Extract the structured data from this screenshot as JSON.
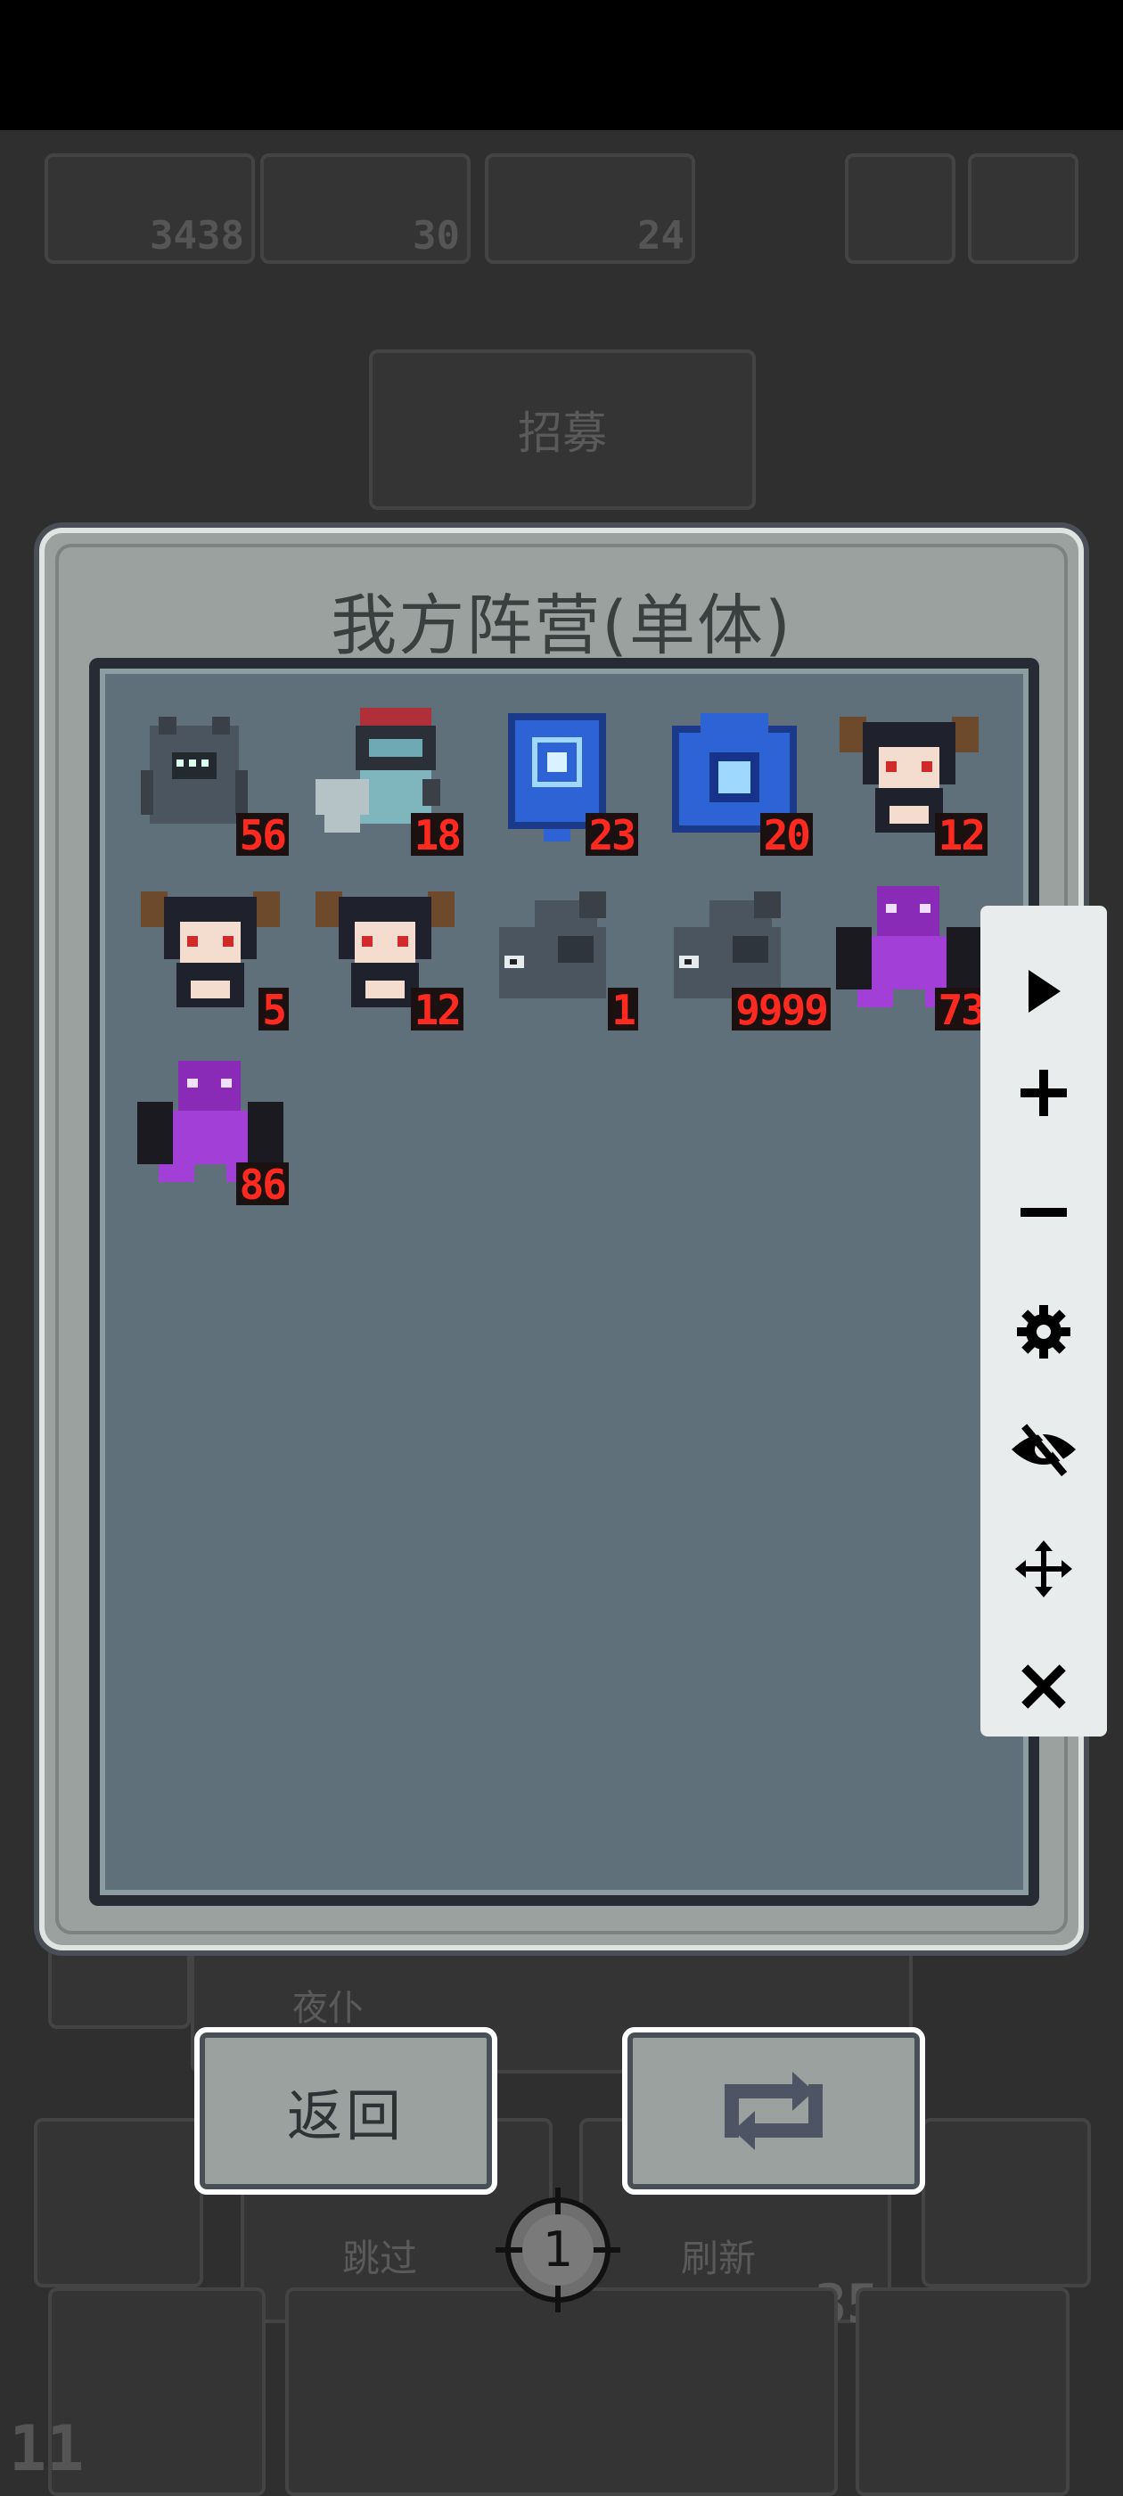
{
  "top_bar": {
    "resources": [
      {
        "icon": "sword-icon",
        "value": "3438"
      },
      {
        "icon": "upgrade-arrow-icon",
        "value": "30"
      },
      {
        "icon": "lightning-icon",
        "value": "24"
      }
    ]
  },
  "background": {
    "recruit_label": "招募",
    "servant_label": "夜仆",
    "skip_label": "跳过",
    "refresh_label": "刷新",
    "cost_value": "35",
    "level_value": "11"
  },
  "dialog": {
    "title": "我方阵营(单体)",
    "units": [
      {
        "type": "gray-spiky-golem",
        "count": "56"
      },
      {
        "type": "cyan-robot-gunner",
        "count": "18"
      },
      {
        "type": "blue-rune-banner",
        "count": "23"
      },
      {
        "type": "blue-rune-chest",
        "count": "20"
      },
      {
        "type": "horned-demon-girl",
        "count": "12"
      },
      {
        "type": "horned-demon-girl",
        "count": "5"
      },
      {
        "type": "horned-demon-girl",
        "count": "12"
      },
      {
        "type": "gray-fish-slug",
        "count": "1"
      },
      {
        "type": "gray-fish-slug",
        "count": "9999"
      },
      {
        "type": "purple-dragon",
        "count": "73"
      },
      {
        "type": "purple-dragon",
        "count": "86"
      }
    ],
    "back_label": "返回",
    "refresh_icon": "refresh-arrows-icon"
  },
  "toolbar": {
    "items": [
      "play-icon",
      "plus-icon",
      "minus-icon",
      "gear-icon",
      "eye-off-icon",
      "move-icon",
      "close-icon"
    ]
  },
  "crosshair_value": "1",
  "colors": {
    "count_text": "#ff2a1f",
    "panel_bg": "#5f707b",
    "dialog_bg": "#9aa19e"
  }
}
